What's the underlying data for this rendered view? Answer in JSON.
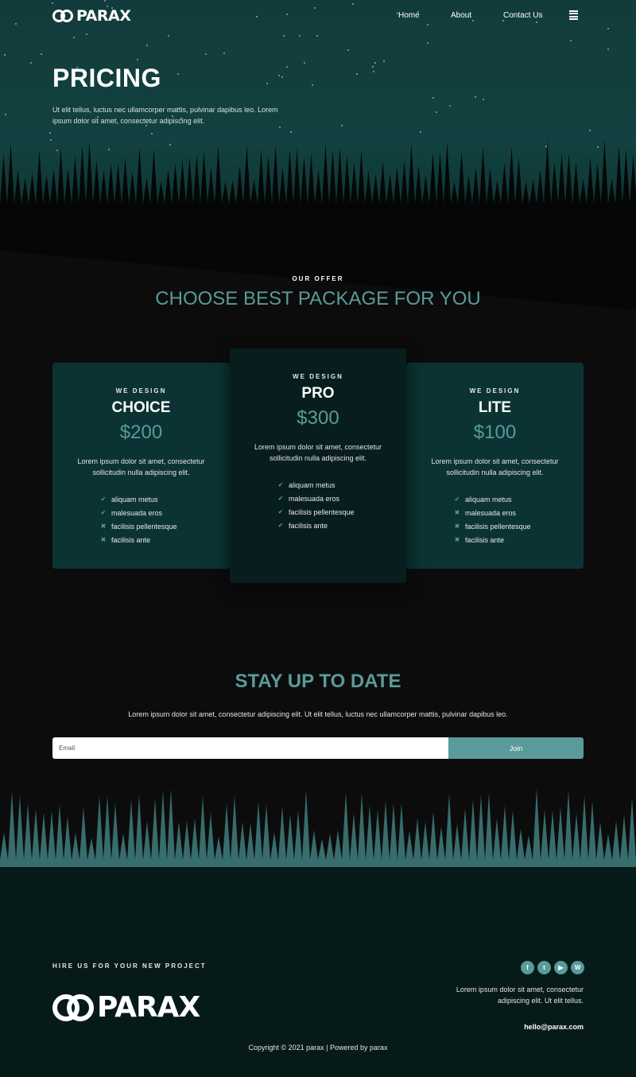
{
  "nav": {
    "logo": "PARAX",
    "items": [
      "Home",
      "About",
      "Contact Us"
    ]
  },
  "hero": {
    "title": "PRICING",
    "subtitle": "Ut elit tellus, luctus nec ullamcorper mattis, pulvinar dapibus leo. Lorem ipsum dolor sit amet, consectetur adipiscing elit."
  },
  "offer": {
    "kicker": "OUR OFFER",
    "title": "CHOOSE BEST PACKAGE FOR YOU"
  },
  "plans": [
    {
      "kicker": "WE DESIGN",
      "name": "CHOICE",
      "price": "$200",
      "description": "Lorem ipsum dolor sit amet, consectetur sollicitudin nulla adipiscing elit.",
      "features": [
        {
          "label": "aliquam metus",
          "included": true
        },
        {
          "label": "malesuada eros",
          "included": true
        },
        {
          "label": "facilisis pellentesque",
          "included": false
        },
        {
          "label": "facilisis ante",
          "included": false
        }
      ]
    },
    {
      "kicker": "WE DESIGN",
      "name": "PRO",
      "price": "$300",
      "description": "Lorem ipsum dolor sit amet, consectetur sollicitudin nulla adipiscing elit.",
      "features": [
        {
          "label": "aliquam metus",
          "included": true
        },
        {
          "label": "malesuada eros",
          "included": true
        },
        {
          "label": "facilisis pellentesque",
          "included": true
        },
        {
          "label": "facilisis ante",
          "included": true
        }
      ]
    },
    {
      "kicker": "WE DESIGN",
      "name": "LITE",
      "price": "$100",
      "description": "Lorem ipsum dolor sit amet, consectetur sollicitudin nulla adipiscing elit.",
      "features": [
        {
          "label": "aliquam metus",
          "included": true
        },
        {
          "label": "malesuada eros",
          "included": false
        },
        {
          "label": "facilisis pellentesque",
          "included": false
        },
        {
          "label": "facilisis ante",
          "included": false
        }
      ]
    }
  ],
  "newsletter": {
    "title": "STAY UP TO DATE",
    "text": "Lorem ipsum dolor sit amet, consectetur adipiscing elit. Ut elit tellus, luctus nec ullamcorper mattis, pulvinar dapibus leo.",
    "placeholder": "Email",
    "button": "Join"
  },
  "footer": {
    "hire": "HIRE US FOR YOUR NEW PROJECT",
    "logo": "PARAX",
    "socials": [
      "facebook-icon",
      "twitter-icon",
      "youtube-icon",
      "wordpress-icon"
    ],
    "text": "Lorem ipsum dolor sit amet, consectetur adipiscing elit. Ut elit tellus.",
    "email": "hello@parax.com",
    "copyright": "Copyright © 2021 parax | Powered by parax"
  },
  "colors": {
    "accent": "#5a9a9a",
    "hero": "#114140",
    "card": "#0c3333",
    "card_featured": "#081e1e",
    "footer": "#071a1a"
  }
}
